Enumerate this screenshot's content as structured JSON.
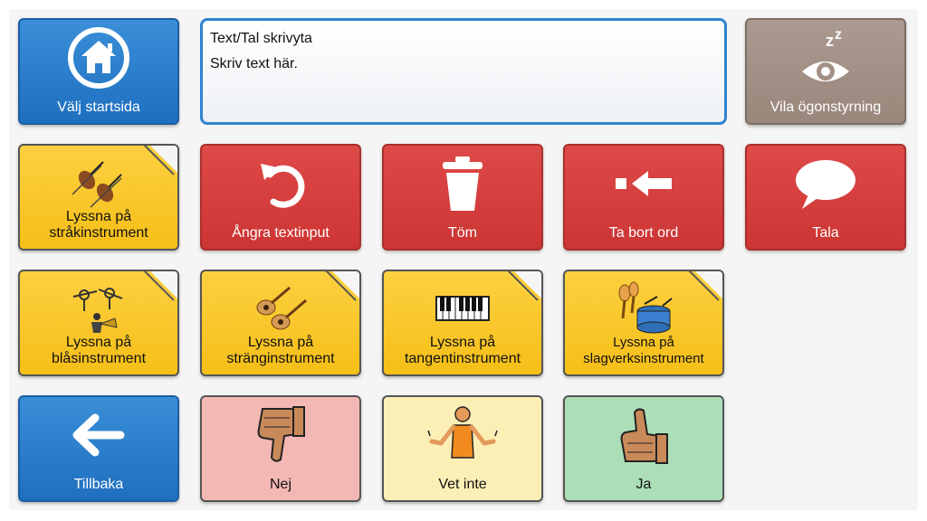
{
  "top_row": {
    "home_label": "Välj startsida",
    "text_area": {
      "title": "Text/Tal skrivyta",
      "placeholder_text": "Skriv text här."
    },
    "rest_label": "Vila ögonstyrning"
  },
  "row2": {
    "strings_label_1": "Lyssna på",
    "strings_label_2": "stråkinstrument",
    "undo_label": "Ångra textinput",
    "clear_label": "Töm",
    "delete_word_label": "Ta bort ord",
    "speak_label": "Tala"
  },
  "row3": {
    "wind_label_1": "Lyssna på",
    "wind_label_2": "blåsinstrument",
    "string_instr_label_1": "Lyssna på",
    "string_instr_label_2": "stränginstrument",
    "keyboard_label_1": "Lyssna på",
    "keyboard_label_2": "tangentinstrument",
    "percussion_label_1": "Lyssna på",
    "percussion_label_2": "slagverksinstrument"
  },
  "row4": {
    "back_label": "Tillbaka",
    "no_label": "Nej",
    "dont_know_label": "Vet inte",
    "yes_label": "Ja"
  },
  "colors": {
    "blue": "#2a7fcf",
    "red": "#d63f3d",
    "taupe": "#a39185",
    "yellow": "#f9c72a",
    "pink": "#f4b8b4",
    "cream": "#fcefb6",
    "green": "#acdfb8"
  },
  "icons": [
    "home-icon",
    "eye-sleep-icon",
    "violins-icon",
    "undo-icon",
    "trash-icon",
    "backspace-arrow-icon",
    "speech-bubble-icon",
    "wind-instruments-icon",
    "guitars-icon",
    "piano-keys-icon",
    "drum-maracas-icon",
    "left-arrow-icon",
    "thumbs-down-icon",
    "shrug-person-icon",
    "thumbs-up-icon"
  ]
}
